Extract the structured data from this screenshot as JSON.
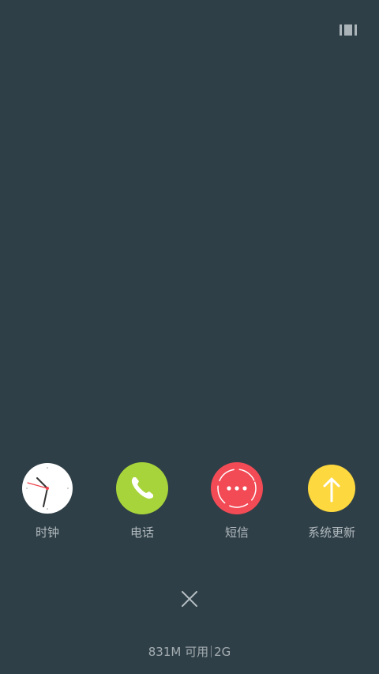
{
  "header": {
    "top_icon": "recent-apps-icon"
  },
  "apps": [
    {
      "label": "时钟",
      "icon": "clock-icon",
      "color": "#ffffff"
    },
    {
      "label": "电话",
      "icon": "phone-icon",
      "color": "#a8d43b"
    },
    {
      "label": "短信",
      "icon": "message-icon",
      "color": "#f24b56"
    },
    {
      "label": "系统更新",
      "icon": "update-icon",
      "color": "#fdd83f"
    }
  ],
  "footer": {
    "close_icon": "close-icon",
    "memory_available": "831M 可用",
    "memory_total": "2G"
  },
  "colors": {
    "background": "#2f3f47",
    "label_text": "#b1babe"
  }
}
